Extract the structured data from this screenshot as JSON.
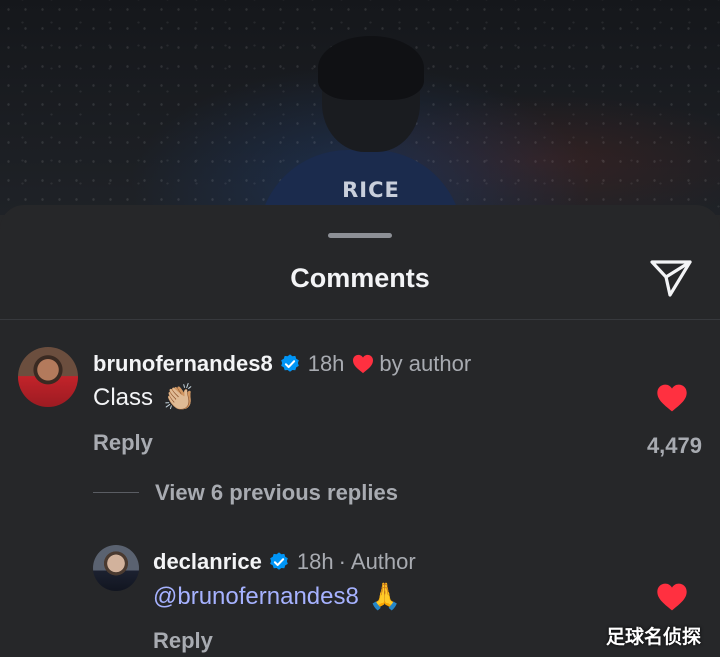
{
  "hero": {
    "shirt_name": "RICE"
  },
  "sheet": {
    "title": "Comments",
    "share_icon": "send-paper-plane-icon"
  },
  "comments": [
    {
      "username": "brunofernandes8",
      "verified": true,
      "time": "18h",
      "separator": "",
      "liked_by_author_label": "by author",
      "text": "Class",
      "emoji": "👏🏼",
      "reply_label": "Reply",
      "like_count": "4,479",
      "liked": true
    },
    {
      "username": "declanrice",
      "verified": true,
      "time": "18h",
      "separator": "·",
      "author_label": "Author",
      "mention": "@brunofernandes8",
      "emoji": "🙏",
      "reply_label": "Reply",
      "liked": true
    }
  ],
  "thread": {
    "view_replies_label": "View 6 previous replies"
  },
  "watermark": "足球名侦探",
  "colors": {
    "background": "#262729",
    "heart_red": "#ff3040",
    "verified_blue": "#0095f6",
    "mention_blue": "#a6b2ff",
    "secondary_text": "#a8abb1"
  }
}
